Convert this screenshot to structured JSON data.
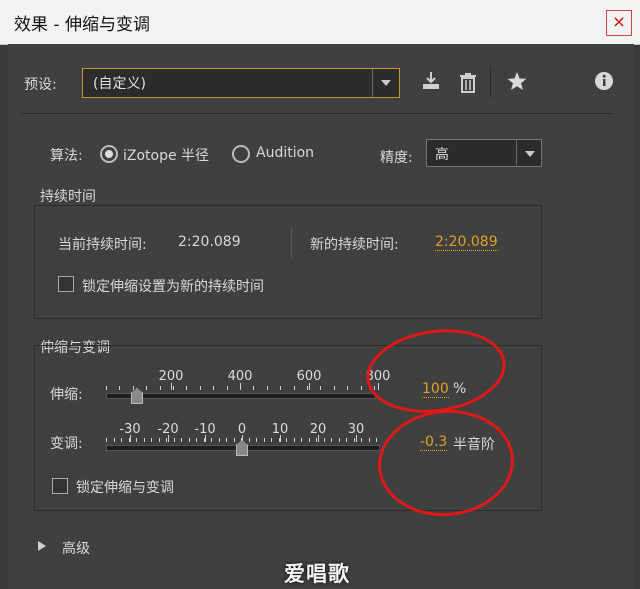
{
  "window": {
    "title": "效果 - 伸缩与变调",
    "close_icon": "×"
  },
  "preset": {
    "label": "预设:",
    "value": "(自定义)"
  },
  "toolbar": {
    "save_icon": "save-preset-icon",
    "delete_icon": "delete-preset-icon",
    "favorite_icon": "favorite-icon",
    "info_icon": "info-icon"
  },
  "algorithm": {
    "label": "算法:",
    "options": [
      {
        "label": "iZotope 半径",
        "selected": true
      },
      {
        "label": "Audition",
        "selected": false
      }
    ]
  },
  "precision": {
    "label": "精度:",
    "value": "高"
  },
  "duration": {
    "group_title": "持续时间",
    "current_label": "当前持续时间:",
    "current_value": "2:20.089",
    "new_label": "新的持续时间:",
    "new_value": "2:20.089",
    "lock_label": "锁定伸缩设置为新的持续时间",
    "lock_checked": false
  },
  "stretch_pitch": {
    "group_title": "伸缩与变调",
    "stretch": {
      "label": "伸缩:",
      "ticks": [
        "200",
        "400",
        "600",
        "800"
      ],
      "value": "100",
      "unit": "%"
    },
    "pitch": {
      "label": "变调:",
      "ticks": [
        "-30",
        "-20",
        "-10",
        "0",
        "10",
        "20",
        "30"
      ],
      "value": "-0.3",
      "unit": "半音阶"
    },
    "lock_label": "锁定伸缩与变调",
    "lock_checked": false
  },
  "advanced": {
    "label": "高级",
    "expanded": false
  },
  "watermark": "爱唱歌",
  "colors": {
    "accent": "#e0a020",
    "annotation": "#e01818",
    "panel": "#404040"
  }
}
